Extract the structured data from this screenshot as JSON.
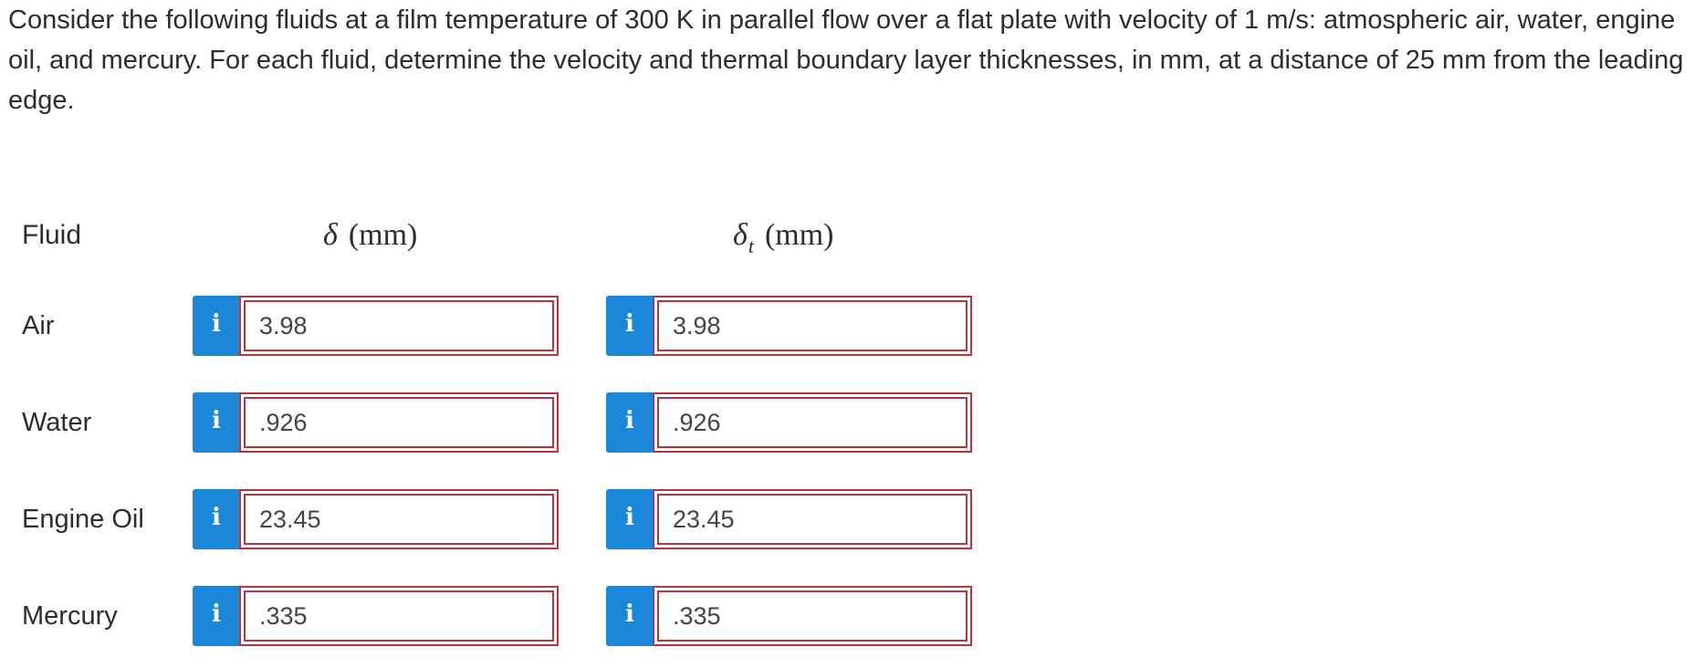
{
  "question": {
    "text": "Consider the following fluids at a film temperature of 300 K in parallel flow over a flat plate with velocity of 1 m/s: atmospheric air, water, engine oil, and mercury. For each fluid, determine the velocity and thermal boundary layer thicknesses, in mm, at a distance of 25 mm from the leading edge."
  },
  "table": {
    "header_fluid": "Fluid",
    "header_delta_symbol": "δ",
    "header_deltat_symbol": "δ",
    "header_deltat_subscript": "t",
    "header_unit": "(mm)",
    "info_glyph": "i",
    "rows": [
      {
        "fluid": "Air",
        "delta": "3.98",
        "delta_t": "3.98"
      },
      {
        "fluid": "Water",
        "delta": ".926",
        "delta_t": ".926"
      },
      {
        "fluid": "Engine Oil",
        "delta": "23.45",
        "delta_t": "23.45"
      },
      {
        "fluid": "Mercury",
        "delta": ".335",
        "delta_t": ".335"
      }
    ]
  },
  "colors": {
    "info_button": "#1b87d8",
    "field_border_incorrect": "#b7353b",
    "text": "#2d2d2d"
  },
  "icons": {
    "info": "info-icon"
  }
}
